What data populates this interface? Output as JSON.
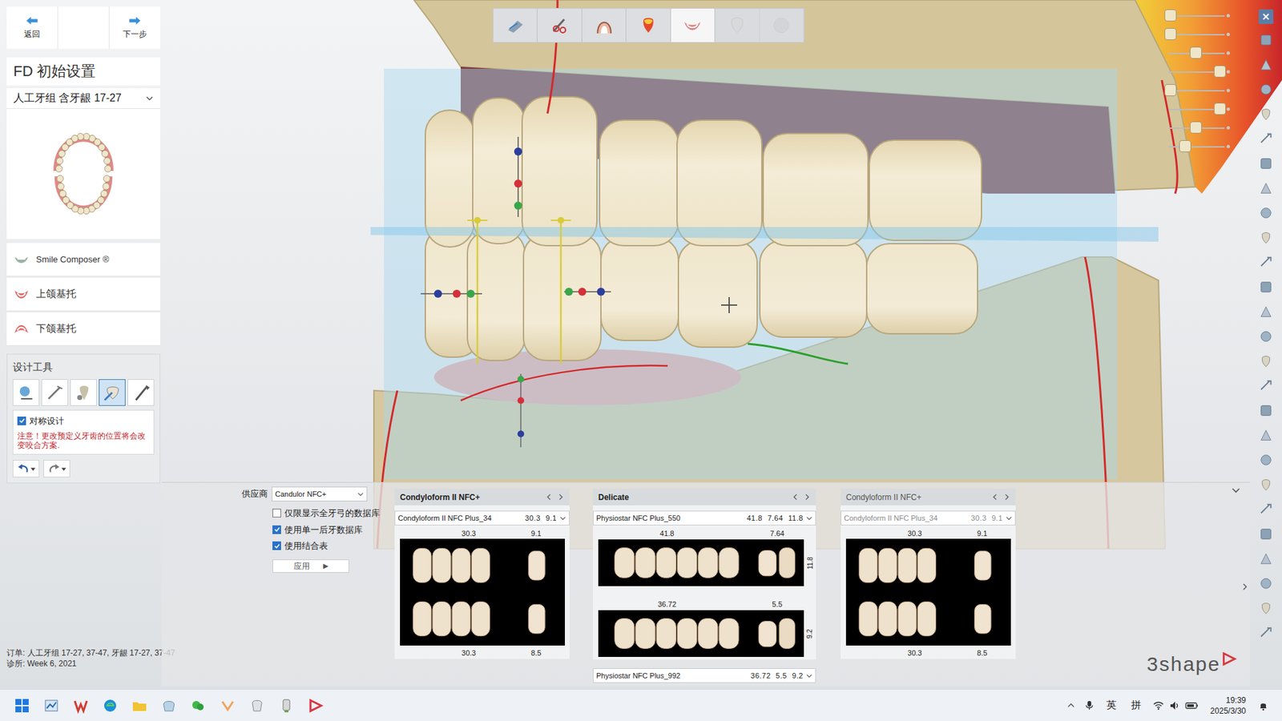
{
  "nav": {
    "back": "返回",
    "next": "下一步"
  },
  "steps": [
    {
      "selected": false,
      "disabled": false
    },
    {
      "selected": false,
      "disabled": false
    },
    {
      "selected": false,
      "disabled": false
    },
    {
      "selected": false,
      "disabled": false
    },
    {
      "selected": true,
      "disabled": false
    },
    {
      "selected": false,
      "disabled": true
    },
    {
      "selected": false,
      "disabled": true
    }
  ],
  "sidebar": {
    "title": "FD 初始设置",
    "tooth_set": "人工牙组 含牙龈 17-27",
    "sections": [
      {
        "label": "Smile Composer ®",
        "kind": "smile"
      },
      {
        "label": "上颌基托",
        "kind": "upper"
      },
      {
        "label": "下颌基托",
        "kind": "lower"
      }
    ]
  },
  "design_tools": {
    "title": "设计工具",
    "tools": [
      {
        "selected": false
      },
      {
        "selected": false
      },
      {
        "selected": false
      },
      {
        "selected": true
      },
      {
        "selected": false
      }
    ],
    "symmetric": {
      "label": "对称设计",
      "checked": true
    },
    "warning": "注意！更改预定义牙齿的位置将会改变咬合方案."
  },
  "order_info": [
    "订单: 人工牙组 17-27, 37-47, 牙龈 17-27, 37-47",
    "诊所: Week 6, 2021"
  ],
  "library": {
    "supplier_label": "供应商",
    "supplier": "Candulor NFC+",
    "options": [
      {
        "label": "仅限显示全牙弓的数据库",
        "checked": false
      },
      {
        "label": "使用单一后牙数据库",
        "checked": true
      },
      {
        "label": "使用结合表",
        "checked": true
      }
    ],
    "apply": "应用",
    "apply_icon": "▶"
  },
  "cards": [
    {
      "kind": "combined",
      "title": "Condyloform II NFC+",
      "disabled": false,
      "selector": {
        "name": "Condyloform II NFC Plus_34",
        "size": "30.3 9.1"
      },
      "top_labels": [
        "30.3",
        "9.1"
      ],
      "bottom_labels": [
        "30.3",
        "8.5"
      ]
    },
    {
      "kind": "split",
      "title": "Delicate",
      "disabled": false,
      "selector": {
        "name": "Physiostar NFC Plus_550",
        "size": "41.8 7.64 11.8"
      },
      "upper": {
        "labels": [
          "41.8",
          "7.64"
        ],
        "side": "11.8"
      },
      "lower": {
        "labels": [
          "36.72",
          "5.5"
        ],
        "side": "9.2"
      },
      "footer_selector": {
        "name": "Physiostar NFC Plus_992",
        "size": "36.72 5.5 9.2"
      }
    },
    {
      "kind": "combined",
      "title": "Condyloform II NFC+",
      "disabled": true,
      "selector": {
        "name": "Condyloform II NFC Plus_34",
        "size": "30.3 9.1"
      },
      "top_labels": [
        "30.3",
        "9.1"
      ],
      "bottom_labels": [
        "30.3",
        "8.5"
      ]
    }
  ],
  "sliders": [
    {
      "level": 0.02
    },
    {
      "level": 0.02
    },
    {
      "level": 0.5
    },
    {
      "level": 0.95
    },
    {
      "level": 0.02
    },
    {
      "level": 0.95
    },
    {
      "level": 0.5
    },
    {
      "level": 0.3
    }
  ],
  "logo": "3shape",
  "taskbar": {
    "ime_lang": "英",
    "ime_mode": "拼",
    "time": "19:39",
    "date": "2025/3/30"
  }
}
